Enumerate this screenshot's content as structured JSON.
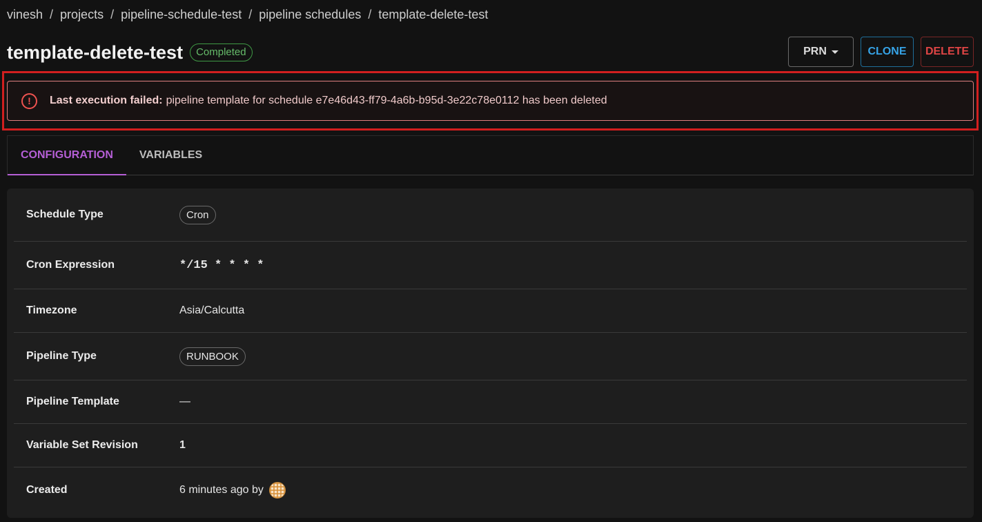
{
  "breadcrumb": {
    "items": [
      "vinesh",
      "projects",
      "pipeline-schedule-test",
      "pipeline schedules",
      "template-delete-test"
    ],
    "separator": "/"
  },
  "header": {
    "title": "template-delete-test",
    "status": "Completed"
  },
  "actions": {
    "prn_label": "PRN",
    "clone_label": "CLONE",
    "delete_label": "DELETE"
  },
  "alert": {
    "icon": "alert-circle-icon",
    "icon_glyph": "!",
    "title": "Last execution failed:",
    "message": "pipeline template for schedule e7e46d43-ff79-4a6b-b95d-3e22c78e0112 has been deleted"
  },
  "tabs": [
    {
      "label": "CONFIGURATION",
      "active": true
    },
    {
      "label": "VARIABLES",
      "active": false
    }
  ],
  "details": {
    "schedule_type": {
      "label": "Schedule Type",
      "value": "Cron"
    },
    "cron_expression": {
      "label": "Cron Expression",
      "value": "*/15 * * * *"
    },
    "timezone": {
      "label": "Timezone",
      "value": "Asia/Calcutta"
    },
    "pipeline_type": {
      "label": "Pipeline Type",
      "value": "RUNBOOK"
    },
    "pipeline_template": {
      "label": "Pipeline Template",
      "value": "—"
    },
    "variable_set_revision": {
      "label": "Variable Set Revision",
      "value": "1"
    },
    "created": {
      "label": "Created",
      "value": "6 minutes ago by"
    }
  },
  "colors": {
    "accent": "#b55fd6",
    "success": "#66bb6a",
    "error": "#ef5350",
    "info": "#36a3e6"
  }
}
